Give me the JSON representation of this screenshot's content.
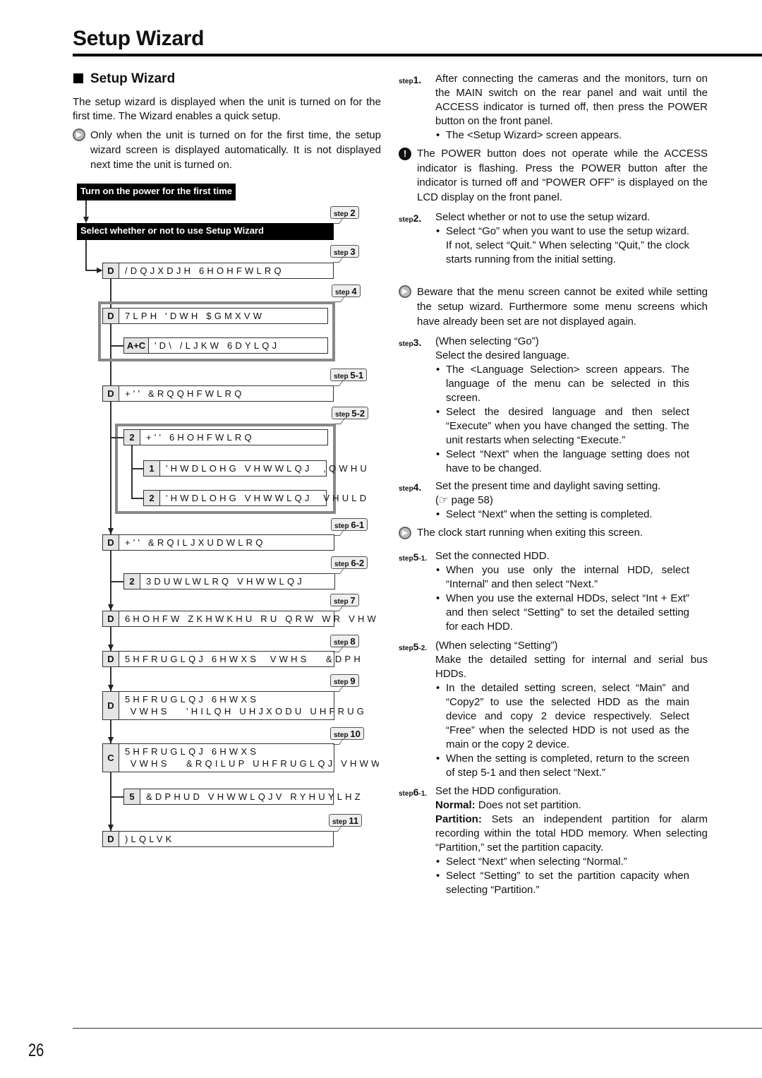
{
  "header": {
    "title": "Setup Wizard"
  },
  "section": {
    "title": "Setup Wizard"
  },
  "intro": "The setup wizard is displayed when the unit is turned on for the first time. The Wizard enables a quick setup.",
  "intro_note": "Only when the unit is turned on for the first time, the setup wizard screen is displayed automatically. It is not displayed next time the unit is turned on.",
  "flow": {
    "start": "Turn on the power for the first time",
    "select": "Select whether or not to use Setup Wizard",
    "steps": [
      "step",
      "2",
      "3",
      "4",
      "5-1",
      "5-2",
      "6-1",
      "6-2",
      "7",
      "8",
      "9",
      "10",
      "11"
    ],
    "boxes": [
      {
        "key": "D",
        "text": "/DQJXDJH 6HOHFWLRQ"
      },
      {
        "key": "D",
        "text": "7LPH 'DWH $GMXVW"
      },
      {
        "key": "A+C",
        "text": "'D\\ /LJKW 6DYLQJ"
      },
      {
        "key": "D",
        "text": "+'' &RQQHFWLRQ"
      },
      {
        "key": "2",
        "text": "+'' 6HOHFWLRQ"
      },
      {
        "key": "1",
        "text": "'HWDLOHG VHWWLQJ  ,QWHU"
      },
      {
        "key": "2",
        "text": "'HWDLOHG VHWWLQJ  VHULD"
      },
      {
        "key": "D",
        "text": "+'' &RQILJXUDWLRQ"
      },
      {
        "key": "2",
        "text": "3DUWLWLRQ VHWWLQJ"
      },
      {
        "key": "D",
        "text": "6HOHFW ZKHWKHU RU QRW WR VHW QRU"
      },
      {
        "key": "D",
        "text": "5HFRUGLQJ 6HWXS  VWHS   &DPH"
      },
      {
        "key": "D",
        "text": "5HFRUGLQJ 6HWXS\n VWHS   'HILQH UHJXODU UHFRUG"
      },
      {
        "key": "C",
        "text": "5HFRUGLQJ 6HWXS\n VWHS   &RQILUP UHFRUGLQJ VHWWL"
      },
      {
        "key": "5",
        "text": "&DPHUD VHWWLQJV RYHUYLHZ"
      },
      {
        "key": "D",
        "text": ")LQLVK"
      }
    ]
  },
  "right": {
    "step1": {
      "label": "step",
      "num": "1.",
      "text": "After connecting the cameras and the monitors, turn on the MAIN switch on the rear panel and wait until the ACCESS indicator is turned off, then press the POWER button on the front panel.",
      "bullets": [
        "The <Setup Wizard> screen appears."
      ]
    },
    "warn1": "The POWER button does not operate while the ACCESS indicator is flashing. Press the POWER button after the indicator is turned off and “POWER OFF” is displayed on the LCD display on the front panel.",
    "step2": {
      "label": "step",
      "num": "2.",
      "text": "Select whether or not to use the setup wizard.",
      "bullets": [
        "Select “Go” when you want to use the setup wizard. If not, select “Quit.” When selecting “Quit,” the clock starts running from the initial setting."
      ]
    },
    "note2": "Beware that the menu screen cannot be exited while setting the setup wizard. Furthermore some menu screens which have already been set are not displayed again.",
    "step3": {
      "label": "step",
      "num": "3.",
      "lines": [
        "(When selecting “Go”)",
        "Select the desired language."
      ],
      "bullets": [
        "The <Language Selection> screen appears. The language of the menu can be selected in this screen.",
        "Select the desired language and then select “Execute” when you have changed the setting. The unit restarts when selecting “Execute.”",
        "Select “Next” when the language setting does not have to be changed."
      ]
    },
    "step4": {
      "label": "step",
      "num": "4.",
      "text": "Set the present time and daylight saving setting.",
      "ref": "(☞ page 58)",
      "bullets": [
        "Select “Next” when the setting is completed."
      ]
    },
    "note4": "The clock start running when exiting this screen.",
    "step51": {
      "label": "step",
      "num": "5",
      "sub": "-1.",
      "text": "Set the connected HDD.",
      "bullets": [
        "When you use only the internal HDD, select “Internal” and then select “Next.”",
        "When you use the external HDDs, select “Int + Ext” and then select “Setting” to set the detailed setting for each HDD."
      ]
    },
    "step52": {
      "label": "step",
      "num": "5",
      "sub": "-2.",
      "lines": [
        "(When selecting “Setting”)",
        "Make the detailed setting for internal and serial bus HDDs."
      ],
      "bullets": [
        "In the detailed setting screen, select “Main” and “Copy2” to use the selected HDD as the main device and copy 2 device respectively. Select “Free” when the selected HDD is not used as the main or the copy 2 device.",
        "When the setting is completed, return to the screen of step 5-1 and then select “Next.”"
      ]
    },
    "step61": {
      "label": "step",
      "num": "6",
      "sub": "-1.",
      "text": "Set the HDD configuration.",
      "normal_label": "Normal:",
      "normal_text": " Does not set partition.",
      "partition_label": "Partition:",
      "partition_text": " Sets an independent partition for alarm recording within the total HDD memory. When selecting “Partition,” set the partition capacity.",
      "bullets": [
        "Select “Next” when selecting “Normal.”",
        "Select “Setting” to set the partition capacity when selecting “Partition.”"
      ]
    }
  },
  "footer": {
    "page": "26"
  }
}
